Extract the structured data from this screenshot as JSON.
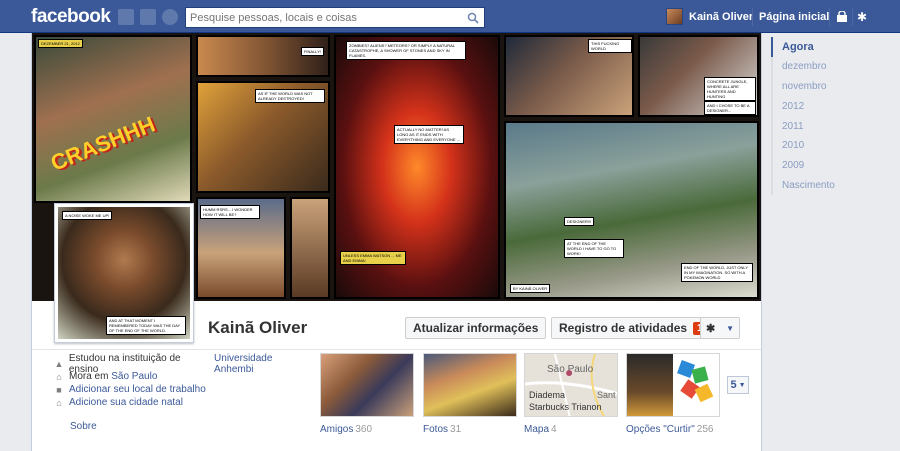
{
  "topbar": {
    "logo": "facebook",
    "search_placeholder": "Pesquise pessoas, locais e coisas",
    "user_name": "Kainã Oliver",
    "home_label": "Página inicial"
  },
  "cover": {
    "date_caption": "DEZEMBER 21, 2012",
    "sfx": "CRASHHH",
    "captions": {
      "finally": "FINALLY!",
      "zombies": "ZOMBIES? ALIENS? METEORS? OR SIMPLY A NATURAL CATASTROPHE, A SHOWER OF STONES AND SKY IN FLAMES.",
      "not_destroyed": "AS IF THE WORLD WAS NOT ALREADY DESTROYED!",
      "actually": "ACTUALLY NO MATTER! AS LONG AS IT ENDS WITH EVERYTHING AND EVERYONE ...",
      "humm": "HUMM RSRS... I WONDER HOW IT WILL BE?",
      "unless": "UNLESS EMMA WATSON ... ME AND EMMA!",
      "noise": "A NOISE WOKE ME UP!",
      "moment": "AND AT THAT MOMENT I REMEMBERED TODAY WAS THE DAY OF THE END OF THE WORLD.",
      "fucking": "THIS FUCKING WORLD",
      "concrete": "CONCRETE JUNGLE, WHERE ALL ARE HUNTERS AND HUNTING",
      "designer": "AND I CHOSE TO BE A DESIGNER...",
      "designer2": "DESIGNER!!!",
      "end": "AT THE END OF THE WORLD I HAVE TO GO TO WORK!",
      "pokemon": "END OF THE WORLD, JUST ONLY IN MY IMAGINATION. SO WITH A POKEMON WORLD",
      "sign": "BY KAINÃ OLIVER"
    }
  },
  "profile": {
    "name": "Kainã Oliver",
    "update_info": "Atualizar informações",
    "activity_log": "Registro de atividades",
    "activity_badge": "1"
  },
  "info": {
    "education_prefix": "Estudou na instituição de ensino",
    "education_link": "Universidade Anhembi",
    "lives_prefix": "Mora em",
    "lives_link": "São Paulo",
    "add_workplace": "Adicionar seu local de trabalho",
    "add_hometown": "Adicione sua cidade natal",
    "about": "Sobre"
  },
  "tiles": [
    {
      "label": "Amigos",
      "count": "360"
    },
    {
      "label": "Fotos",
      "count": "31"
    },
    {
      "label": "Mapa",
      "count": "4"
    },
    {
      "label": "Opções \"Curtir\"",
      "count": "256"
    }
  ],
  "map_labels": {
    "top": "São Paulo",
    "left": "Diadema",
    "bottom": "Starbucks Trianon",
    "edge": "Sant"
  },
  "more_count": "5",
  "timeline": [
    "Agora",
    "dezembro",
    "novembro",
    "2012",
    "2011",
    "2010",
    "2009",
    "Nascimento"
  ],
  "colors": {
    "brand": "#3b5998",
    "badge": "#dd3c10"
  }
}
